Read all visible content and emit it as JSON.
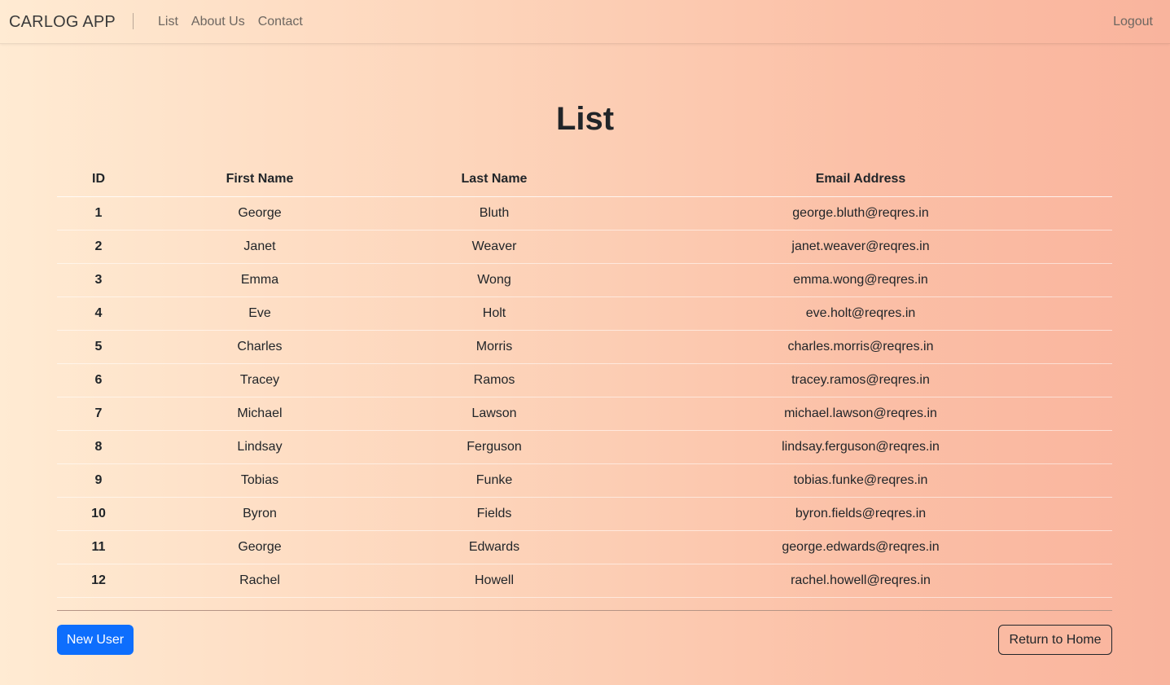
{
  "navbar": {
    "brand": "CARLOG APP",
    "separator": "|",
    "links": [
      {
        "label": "List"
      },
      {
        "label": "About Us"
      },
      {
        "label": "Contact"
      }
    ],
    "logout": "Logout"
  },
  "page": {
    "title": "List"
  },
  "table": {
    "headers": {
      "id": "ID",
      "first_name": "First Name",
      "last_name": "Last Name",
      "email": "Email Address"
    },
    "rows": [
      {
        "id": "1",
        "first_name": "George",
        "last_name": "Bluth",
        "email": "george.bluth@reqres.in"
      },
      {
        "id": "2",
        "first_name": "Janet",
        "last_name": "Weaver",
        "email": "janet.weaver@reqres.in"
      },
      {
        "id": "3",
        "first_name": "Emma",
        "last_name": "Wong",
        "email": "emma.wong@reqres.in"
      },
      {
        "id": "4",
        "first_name": "Eve",
        "last_name": "Holt",
        "email": "eve.holt@reqres.in"
      },
      {
        "id": "5",
        "first_name": "Charles",
        "last_name": "Morris",
        "email": "charles.morris@reqres.in"
      },
      {
        "id": "6",
        "first_name": "Tracey",
        "last_name": "Ramos",
        "email": "tracey.ramos@reqres.in"
      },
      {
        "id": "7",
        "first_name": "Michael",
        "last_name": "Lawson",
        "email": "michael.lawson@reqres.in"
      },
      {
        "id": "8",
        "first_name": "Lindsay",
        "last_name": "Ferguson",
        "email": "lindsay.ferguson@reqres.in"
      },
      {
        "id": "9",
        "first_name": "Tobias",
        "last_name": "Funke",
        "email": "tobias.funke@reqres.in"
      },
      {
        "id": "10",
        "first_name": "Byron",
        "last_name": "Fields",
        "email": "byron.fields@reqres.in"
      },
      {
        "id": "11",
        "first_name": "George",
        "last_name": "Edwards",
        "email": "george.edwards@reqres.in"
      },
      {
        "id": "12",
        "first_name": "Rachel",
        "last_name": "Howell",
        "email": "rachel.howell@reqres.in"
      }
    ]
  },
  "actions": {
    "new_user": "New User",
    "return_home": "Return to Home"
  },
  "colors": {
    "primary_button": "#0d6efd",
    "gradient_start": "#ffebd3",
    "gradient_end": "#f9b49d"
  }
}
